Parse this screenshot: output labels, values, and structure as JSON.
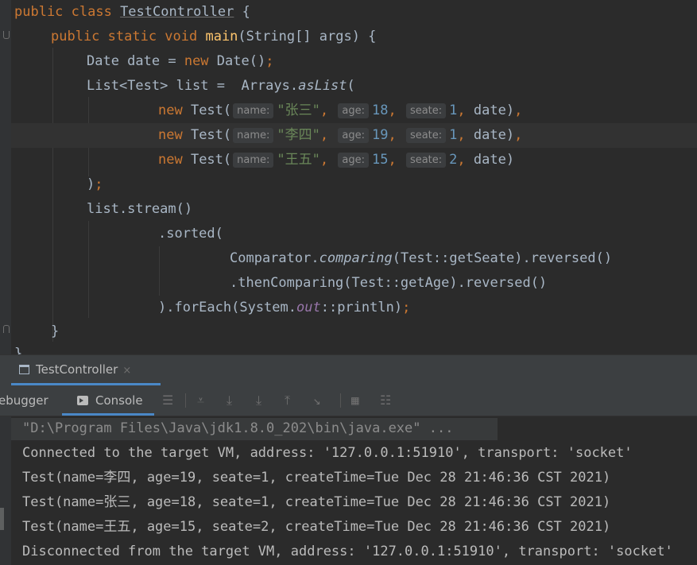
{
  "editor": {
    "class_line": {
      "kw": "public class ",
      "name": "TestController",
      "rest": " {"
    },
    "main_line": {
      "kw": "public static void ",
      "name": "main",
      "rest": "(String[] args) {"
    },
    "date_line": {
      "a": "Date date = ",
      "kw": "new",
      "b": " Date()",
      "semi": ";"
    },
    "list_line": {
      "a": "List<Test> list =  Arrays.",
      "method": "asList",
      "b": "("
    },
    "tests": [
      {
        "name_hint": "name:",
        "name": "\"张三\"",
        "age_hint": "age:",
        "age": "18",
        "seate_hint": "seate:",
        "seate": "1",
        "tail": "date)",
        "sep": ","
      },
      {
        "name_hint": "name:",
        "name": "\"李四\"",
        "age_hint": "age:",
        "age": "19",
        "seate_hint": "seate:",
        "seate": "1",
        "tail": "date)",
        "sep": ","
      },
      {
        "name_hint": "name:",
        "name": "\"王五\"",
        "age_hint": "age:",
        "age": "15",
        "seate_hint": "seate:",
        "seate": "2",
        "tail": "date)",
        "sep": ""
      }
    ],
    "new_kw": "new",
    "test_open": " Test(",
    "comma": ", ",
    "close_list": ")",
    "close_semi": ";",
    "stream_line": "list.stream()",
    "sorted_line": ".sorted(",
    "comparator_line": {
      "a": "Comparator.",
      "method": "comparing",
      "b": "(Test::getSeate).reversed()"
    },
    "then_line": ".thenComparing(Test::getAge).reversed()",
    "foreach_line": {
      "a": ").forEach(System.",
      "field": "out",
      "b": "::println)",
      "semi": ";"
    },
    "close_brace": "}",
    "last_brace": "}"
  },
  "run_panel": {
    "tab_label": "TestController",
    "tab_close": "×",
    "debugger_label": "ebugger",
    "console_label": "Console"
  },
  "console": {
    "lines": [
      "\"D:\\Program Files\\Java\\jdk1.8.0_202\\bin\\java.exe\" ...",
      "Connected to the target VM, address: '127.0.0.1:51910', transport: 'socket'",
      "Test(name=李四, age=19, seate=1, createTime=Tue Dec 28 21:46:36 CST 2021)",
      "Test(name=张三, age=18, seate=1, createTime=Tue Dec 28 21:46:36 CST 2021)",
      "Test(name=王五, age=15, seate=2, createTime=Tue Dec 28 21:46:36 CST 2021)",
      "Disconnected from the target VM, address: '127.0.0.1:51910', transport: 'socket'"
    ]
  }
}
